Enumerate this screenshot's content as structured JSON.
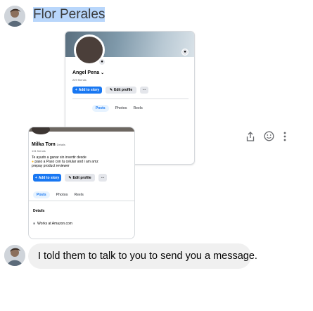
{
  "conversation": {
    "sender_name": "Flor Perales",
    "message_text": "I told them to talk to you to send you a message."
  },
  "screenshot_top": {
    "profile_name": "Angel Pena",
    "friends_count": "229 friends",
    "add_story_label": "Add to story",
    "edit_profile_label": "Edit profile",
    "more_label": "⋯",
    "tabs": [
      "Posts",
      "Photos",
      "Reels"
    ]
  },
  "screenshot_bottom": {
    "profile_name": "Milka Tom",
    "details_link": "Details",
    "friends_count": "131 friends",
    "intro_line_1": "Te ayudo a ganar sin invertir desde",
    "intro_line_2": "paso a Paso con tu celular and i am amz",
    "intro_line_3": "prepay product reviewer",
    "add_story_label": "Add to story",
    "edit_profile_label": "Edit profile",
    "more_label": "⋯",
    "tabs": [
      "Posts",
      "Photos",
      "Reels"
    ],
    "details_heading": "Details",
    "works_at": "Works at Amazon.com"
  },
  "colors": {
    "accent": "#1877f2",
    "selection": "#b8d6fb",
    "bubble": "#f0f0f0"
  }
}
